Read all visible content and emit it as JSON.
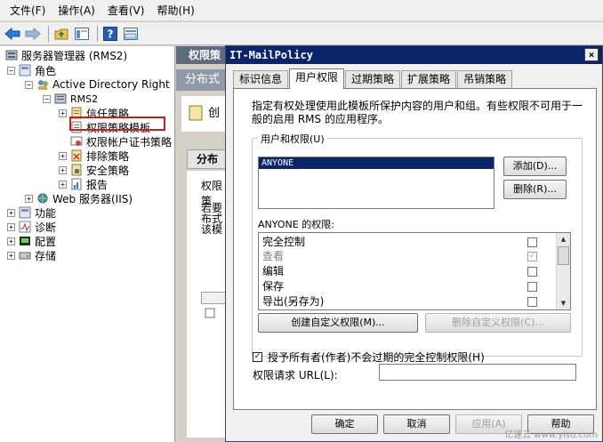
{
  "menubar": {
    "items": [
      "文件(F)",
      "操作(A)",
      "查看(V)",
      "帮助(H)"
    ]
  },
  "tree": {
    "root": "服务器管理器 (RMS2)",
    "role": "角色",
    "adrms": "Active Directory Right",
    "server": "RMS2",
    "trust": "信任策略",
    "template": "权限策略模板",
    "certs": "权限帐户证书策略",
    "exclude": "排除策略",
    "security": "安全策略",
    "reports": "报告",
    "iis": "Web 服务器(IIS)",
    "features": "功能",
    "diagnostics": "诊断",
    "config": "配置",
    "storage": "存储"
  },
  "background": {
    "header": "权限策",
    "subheader": "分布式",
    "section": "分布式",
    "lines": [
      "权限策",
      "若要",
      "布式",
      "该模"
    ],
    "icon_text": "创"
  },
  "dialog": {
    "title": "IT-MailPolicy",
    "close": "×",
    "tabs": [
      "标识信息",
      "用户权限",
      "过期策略",
      "扩展策略",
      "吊销策略"
    ],
    "active_tab": 1,
    "description": "指定有权处理使用此模板所保护内容的用户和组。有些权限不可用于一般的启用 RMS 的应用程序。",
    "users_group": "用户和权限(U)",
    "users": [
      "ANYONE"
    ],
    "add_button": "添加(D)...",
    "remove_button": "删除(R)...",
    "permissions_label": "ANYONE 的权限:",
    "permissions": [
      {
        "name": "完全控制",
        "checked": false,
        "enabled": true
      },
      {
        "name": "查看",
        "checked": true,
        "enabled": false
      },
      {
        "name": "编辑",
        "checked": false,
        "enabled": true
      },
      {
        "name": "保存",
        "checked": false,
        "enabled": true
      },
      {
        "name": "导出(另存为)",
        "checked": false,
        "enabled": true
      }
    ],
    "create_custom": "创建自定义权限(M)...",
    "delete_custom": "删除自定义权限(C)...",
    "grant_label": "授予所有者(作者)不会过期的完全控制权限(H)",
    "grant_checked": true,
    "url_label": "权限请求 URL(L):",
    "url_value": "",
    "buttons": {
      "ok": "确定",
      "cancel": "取消",
      "apply": "应用(A)",
      "help": "帮助"
    }
  },
  "watermark": "亿速云 www.yisu.com"
}
